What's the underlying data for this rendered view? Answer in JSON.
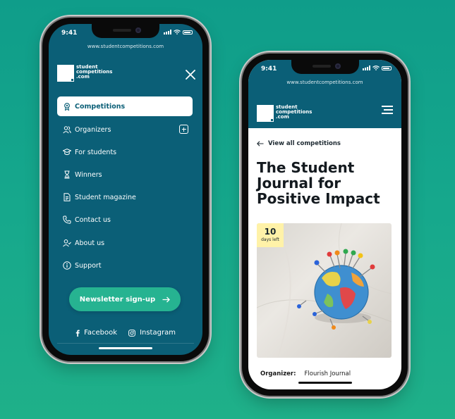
{
  "statusbar": {
    "time": "9:41"
  },
  "browser": {
    "url": "www.studentcompetitions.com"
  },
  "brand": {
    "logo_line1": "student",
    "logo_line2": "competitions",
    "logo_line3": ".com"
  },
  "menu": {
    "items": [
      {
        "label": "Competitions",
        "icon": "award-icon"
      },
      {
        "label": "Organizers",
        "icon": "users-icon"
      },
      {
        "label": "For students",
        "icon": "graduation-cap-icon"
      },
      {
        "label": "Winners",
        "icon": "hourglass-icon"
      },
      {
        "label": "Student magazine",
        "icon": "document-icon"
      },
      {
        "label": "Contact us",
        "icon": "phone-icon"
      },
      {
        "label": "About us",
        "icon": "user-check-icon"
      },
      {
        "label": "Support",
        "icon": "info-icon"
      }
    ],
    "newsletter_label": "Newsletter sign-up",
    "social": {
      "facebook": "Facebook",
      "instagram": "Instagram"
    }
  },
  "competition": {
    "back_label": "View all competitions",
    "title": "The Student Journal for Positive Impact",
    "days_left_value": "10",
    "days_left_label": "days left",
    "organizer_key": "Organizer:",
    "organizer_value": "Flourish Journal"
  },
  "colors": {
    "brand_teal": "#0b5f77",
    "accent_green": "#26b391",
    "badge_yellow": "#fff2a8",
    "background": "#16a88c"
  }
}
